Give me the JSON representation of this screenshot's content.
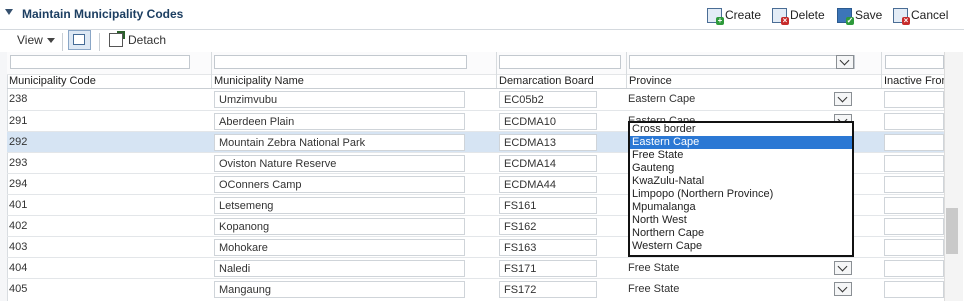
{
  "header": {
    "title": "Maintain Municipality Codes",
    "create_label": "Create",
    "delete_label": "Delete",
    "save_label": "Save",
    "cancel_label": "Cancel"
  },
  "toolbar": {
    "view_label": "View",
    "detach_label": "Detach"
  },
  "columns": {
    "code": "Municipality Code",
    "name": "Municipality Name",
    "board": "Demarcation Board",
    "province": "Province",
    "inactive": "Inactive From"
  },
  "rows": [
    {
      "code": "238",
      "name": "Umzimvubu",
      "board": "EC05b2",
      "province": "Eastern Cape"
    },
    {
      "code": "291",
      "name": "Aberdeen Plain",
      "board": "ECDMA10",
      "province": "Eastern Cape"
    },
    {
      "code": "292",
      "name": "Mountain Zebra National Park",
      "board": "ECDMA13",
      "province": ""
    },
    {
      "code": "293",
      "name": "Oviston Nature Reserve",
      "board": "ECDMA14",
      "province": ""
    },
    {
      "code": "294",
      "name": "OConners Camp",
      "board": "ECDMA44",
      "province": ""
    },
    {
      "code": "401",
      "name": "Letsemeng",
      "board": "FS161",
      "province": ""
    },
    {
      "code": "402",
      "name": "Kopanong",
      "board": "FS162",
      "province": ""
    },
    {
      "code": "403",
      "name": "Mohokare",
      "board": "FS163",
      "province": ""
    },
    {
      "code": "404",
      "name": "Naledi",
      "board": "FS171",
      "province": "Free State"
    },
    {
      "code": "405",
      "name": "Mangaung",
      "board": "FS172",
      "province": "Free State"
    }
  ],
  "province_options": [
    "Cross border",
    "Eastern Cape",
    "Free State",
    "Gauteng",
    "KwaZulu-Natal",
    "Limpopo (Northern Province)",
    "Mpumalanga",
    "North West",
    "Northern Cape",
    "Western Cape"
  ],
  "province_selected": "Eastern Cape",
  "colors": {
    "selected_row": "#d6e4f3",
    "selected_option": "#2b78d4",
    "title": "#1c3e61"
  }
}
